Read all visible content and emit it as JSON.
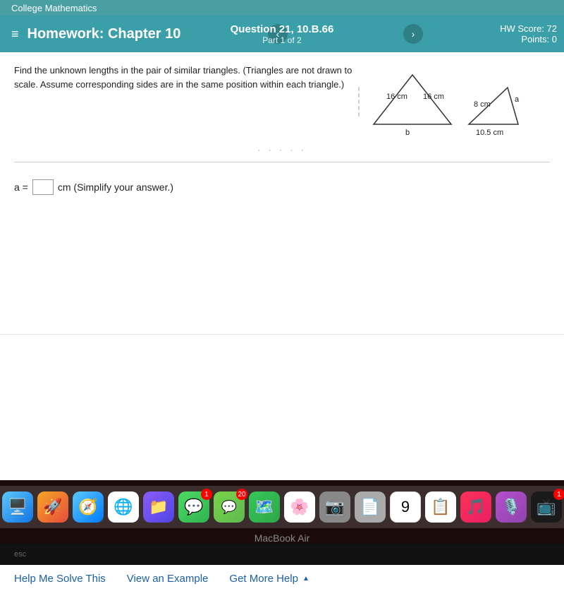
{
  "college_header": {
    "text": "College Mathematics"
  },
  "header": {
    "hamburger": "≡",
    "title": "Homework: Chapter 10",
    "question_number": "Question 21, 10.B.66",
    "question_part": "Part 1 of 2",
    "nav_left": "‹",
    "nav_right": "›",
    "hw_score_label": "HW Score: 72",
    "points_label": "Points: 0"
  },
  "problem": {
    "text": "Find the unknown lengths in the pair of similar triangles. (Triangles are not drawn to scale. Assume corresponding sides are in the same position within each triangle.)",
    "triangle1": {
      "side_top_left": "16 cm",
      "side_top_right": "16 cm",
      "side_bottom": "b"
    },
    "triangle2": {
      "side_left": "8 cm",
      "side_right": "a",
      "side_bottom": "10.5 cm"
    }
  },
  "answer": {
    "label": "a =",
    "unit": "cm (Simplify your answer.)",
    "placeholder": ""
  },
  "help_bar": {
    "help_me_solve": "Help Me Solve This",
    "view_example": "View an Example",
    "get_more_help": "Get More Help",
    "chevron": "▲"
  },
  "dock": {
    "label": "MacBook Air",
    "icons": [
      {
        "name": "finder",
        "emoji": "🔵",
        "color": "#1473e6"
      },
      {
        "name": "launchpad",
        "emoji": "🚀",
        "color": "#f5a623"
      },
      {
        "name": "safari",
        "emoji": "🧭",
        "color": "#5ac8fa"
      },
      {
        "name": "chrome",
        "emoji": "🌐",
        "color": "#4285f4"
      },
      {
        "name": "file-manager",
        "emoji": "📁",
        "color": "#8b5cf6"
      },
      {
        "name": "messages",
        "emoji": "💬",
        "color": "#4caf50",
        "badge": "1"
      },
      {
        "name": "wechat",
        "emoji": "💬",
        "color": "#5dba4f",
        "badge": "20"
      },
      {
        "name": "maps",
        "emoji": "🗺️",
        "color": "#34a853"
      },
      {
        "name": "photos",
        "emoji": "🌸",
        "color": "#ff6b9d"
      },
      {
        "name": "camera",
        "emoji": "📷",
        "color": "#555"
      },
      {
        "name": "files",
        "emoji": "📄",
        "color": "#777"
      },
      {
        "name": "calendar",
        "emoji": "📅",
        "color": "#e74c3c"
      },
      {
        "name": "reminders",
        "emoji": "📋",
        "color": "#f39c12"
      },
      {
        "name": "music",
        "emoji": "🎵",
        "color": "#e91e63"
      },
      {
        "name": "podcasts",
        "emoji": "🎙️",
        "color": "#8e44ad"
      },
      {
        "name": "appletv",
        "emoji": "📺",
        "color": "#333",
        "badge": "1"
      }
    ]
  },
  "keyboard": {
    "esc_label": "esc"
  }
}
